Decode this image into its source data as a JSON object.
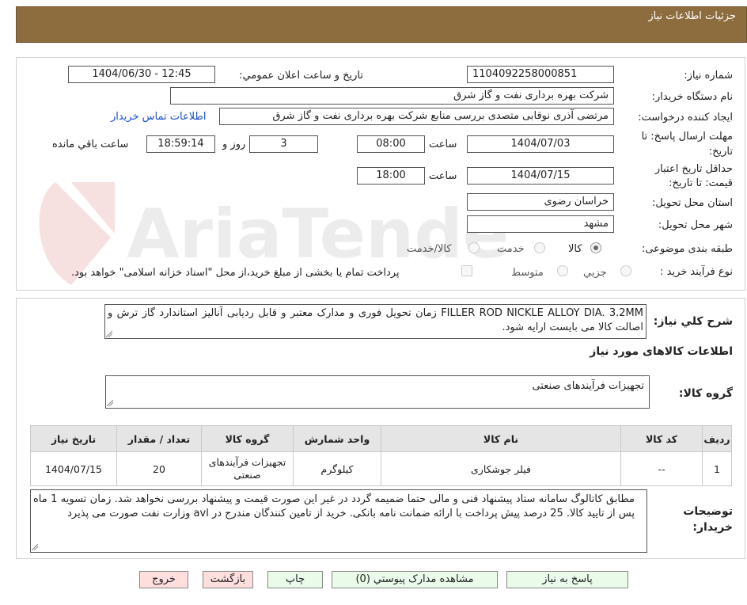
{
  "header": {
    "title": "جزئیات اطلاعات نیاز"
  },
  "form": {
    "need_number": {
      "label": "شماره نیاز:",
      "value": "1104092258000851"
    },
    "announce_datetime": {
      "label": "تاریخ و ساعت اعلان عمومي:",
      "value": "1404/06/30 - 12:45"
    },
    "buyer_org": {
      "label": "نام دستگاه خريدار:",
      "value": "شرکت بهره برداری نفت و گاز شرق"
    },
    "requester": {
      "label": "ایجاد کننده درخواست:",
      "value": "مرتضی آذری نوقابی متصدی بررسی منابع شرکت بهره برداری نفت و گاز شرق",
      "contact_link": "اطلاعات تماس خریدار"
    },
    "reply_deadline": {
      "label_line1": "مهلت ارسال پاسخ: تا",
      "label_line2": "تاریخ:",
      "date": "1404/07/03",
      "time_label": "ساعت",
      "time": "08:00",
      "days": "3",
      "days_label": "روز و",
      "remaining": "18:59:14",
      "remaining_label": "ساعت باقي مانده"
    },
    "price_validity": {
      "label_line1": "حداقل تاریخ اعتبار",
      "label_line2": "قیمت: تا تاریخ:",
      "date": "1404/07/15",
      "time_label": "ساعت",
      "time": "18:00"
    },
    "province": {
      "label": "استان محل تحویل:",
      "value": "خراسان رضوی"
    },
    "city": {
      "label": "شهر محل تحویل:",
      "value": "مشهد"
    },
    "category": {
      "label": "طبقه بندی موضوعی:",
      "options": [
        "کالا",
        "خدمت",
        "کالا/خدمت"
      ],
      "selected": "کالا"
    },
    "process_type": {
      "label": "نوع فرآیند خرید :",
      "options": [
        "جزیي",
        "متوسط"
      ],
      "note": "پرداخت تمام یا بخشی از مبلغ خرید،از محل \"اسناد خزانه اسلامی\" خواهد بود."
    }
  },
  "summary": {
    "label": "شرح کلي نياز:",
    "value": "FILLER ROD NICKLE ALLOY DIA. 3.2MM زمان تحویل فوری و مدارک معتبر و قابل ردیابی آنالیز استاندارد گاز ترش و اصالت کالا می بایست ارایه شود."
  },
  "items_section": {
    "title": "اطلاعات کالاهای مورد نیاز",
    "group_label": "گروه کالا:",
    "group_value": "تجهیزات فرآیندهای صنعتی",
    "columns": [
      "ردیف",
      "کد کالا",
      "نام کالا",
      "واحد شمارش",
      "گروه کالا",
      "تعداد / مقدار",
      "تاریخ نیاز"
    ],
    "rows": [
      {
        "row": "1",
        "code": "--",
        "name": "فیلر جوشکاری",
        "unit": "کیلوگرم",
        "group": "تجهیزات فرآیندهای صنعتی",
        "qty": "20",
        "date": "1404/07/15"
      }
    ]
  },
  "buyer_notes": {
    "label_line1": "توضیحات",
    "label_line2": "خریدار:",
    "value": "مطابق کاتالوگ سامانه ستاد پیشنهاد فنی و مالی حتما ضمیمه گردد در غیر این صورت قیمت و پیشنهاد بررسی نخواهد شد. زمان تسویه 1 ماه پس از تایید کالا. 25 درصد پیش پرداخت با ارائه ضمانت نامه بانکی. خرید از تامین کنندگان مندرج در avl وزارت نفت صورت می پذیرد"
  },
  "buttons": {
    "reply": "پاسخ به نیاز",
    "view_docs": "مشاهده مدارک پیوستي (0)",
    "print": "چاپ",
    "back": "بازگشت",
    "exit": "خروج"
  },
  "watermark": {
    "text": "AriaTender.neT"
  }
}
